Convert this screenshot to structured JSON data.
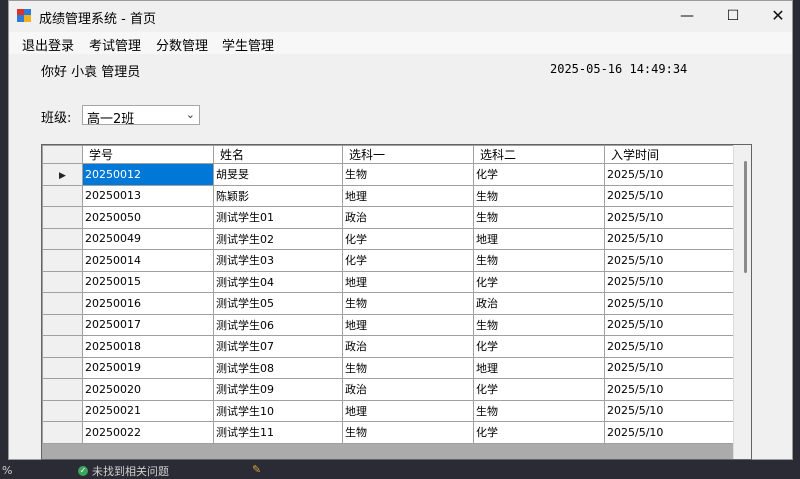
{
  "window": {
    "title": "成绩管理系统 - 首页",
    "controls": {
      "minimize": "—",
      "maximize": "☐",
      "close": "✕"
    }
  },
  "menu": [
    "退出登录",
    "考试管理",
    "分数管理",
    "学生管理"
  ],
  "header": {
    "greeting": "你好  小袁  管理员",
    "datetime": "2025-05-16 14:49:34"
  },
  "filter": {
    "label": "班级:",
    "selected": "高一2班"
  },
  "table": {
    "columns": [
      "学号",
      "姓名",
      "选科一",
      "选科二",
      "入学时间"
    ],
    "rows": [
      [
        "20250012",
        "胡旻旻",
        "生物",
        "化学",
        "2025/5/10"
      ],
      [
        "20250013",
        "陈颖影",
        "地理",
        "生物",
        "2025/5/10"
      ],
      [
        "20250050",
        "测试学生01",
        "政治",
        "生物",
        "2025/5/10"
      ],
      [
        "20250049",
        "测试学生02",
        "化学",
        "地理",
        "2025/5/10"
      ],
      [
        "20250014",
        "测试学生03",
        "化学",
        "生物",
        "2025/5/10"
      ],
      [
        "20250015",
        "测试学生04",
        "地理",
        "化学",
        "2025/5/10"
      ],
      [
        "20250016",
        "测试学生05",
        "生物",
        "政治",
        "2025/5/10"
      ],
      [
        "20250017",
        "测试学生06",
        "地理",
        "生物",
        "2025/5/10"
      ],
      [
        "20250018",
        "测试学生07",
        "政治",
        "化学",
        "2025/5/10"
      ],
      [
        "20250019",
        "测试学生08",
        "生物",
        "地理",
        "2025/5/10"
      ],
      [
        "20250020",
        "测试学生09",
        "政治",
        "化学",
        "2025/5/10"
      ],
      [
        "20250021",
        "测试学生10",
        "地理",
        "生物",
        "2025/5/10"
      ],
      [
        "20250022",
        "测试学生11",
        "生物",
        "化学",
        "2025/5/10"
      ]
    ],
    "selected_row": 0
  },
  "taskbar": {
    "left": "%",
    "status": "未找到相关问题"
  }
}
